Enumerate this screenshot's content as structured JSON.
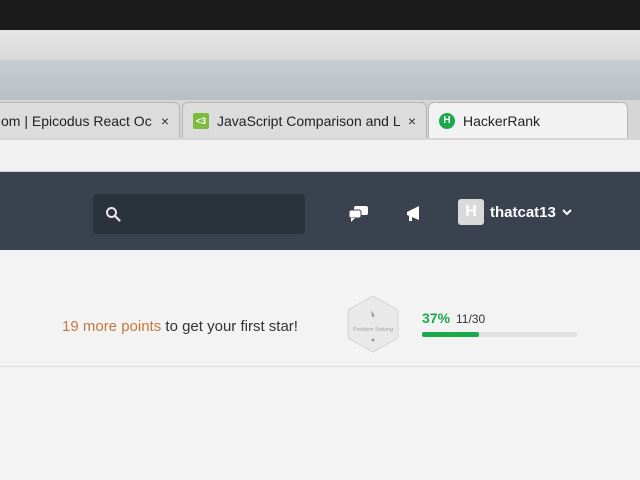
{
  "browser": {
    "tabs": [
      {
        "title": "om | Epicodus React Oc",
        "favicon": "none",
        "active": false
      },
      {
        "title": "JavaScript Comparison and Lo",
        "favicon": "js-favicon",
        "active": false
      },
      {
        "title": "HackerRank",
        "favicon": "hackerrank-favicon",
        "active": true
      }
    ],
    "close_glyph": "×"
  },
  "navbar": {
    "search_placeholder": "",
    "icons": [
      "search-icon",
      "messages-icon",
      "announcements-icon",
      "chevron-down-icon"
    ],
    "username": "thatcat13",
    "avatar_letter": "H"
  },
  "progress": {
    "points_text": "19 more points",
    "rest_text": " to get your first star!",
    "badge_label": "Problem Solving",
    "percent_text": "37%",
    "count_text": "11/30",
    "fraction": 0.37
  },
  "colors": {
    "nav_bg": "#39424e",
    "accent_orange": "#c8773a",
    "hackerrank_green": "#1ba94c"
  }
}
